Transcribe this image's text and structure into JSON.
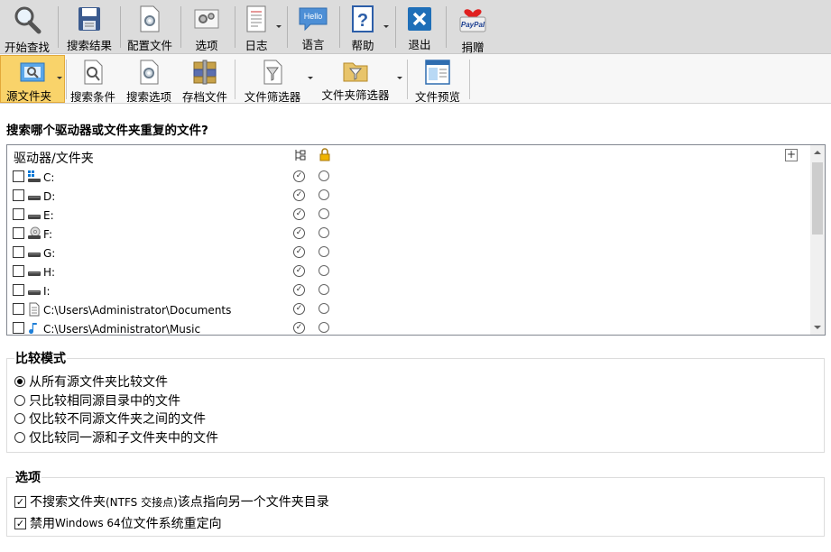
{
  "toolbar_main": {
    "items": [
      {
        "label": "开始查找",
        "icon": "magnifier-icon"
      },
      {
        "label": "搜索结果",
        "icon": "save-disk-icon"
      },
      {
        "label": "配置文件",
        "icon": "config-file-icon"
      },
      {
        "label": "选项",
        "icon": "options-gear-icon"
      },
      {
        "label": "日志",
        "icon": "log-icon"
      },
      {
        "label": "语言",
        "icon": "hello-bubble-icon"
      },
      {
        "label": "帮助",
        "icon": "help-icon"
      },
      {
        "label": "退出",
        "icon": "exit-x-icon"
      },
      {
        "label": "捐赠",
        "icon": "paypal-icon"
      }
    ],
    "hello_text": "Hello",
    "paypal_text": "PayPal"
  },
  "toolbar_sub": {
    "items": [
      {
        "label": "源文件夹",
        "icon": "source-folder-icon",
        "active": true
      },
      {
        "label": "搜索条件",
        "icon": "search-criteria-icon"
      },
      {
        "label": "搜索选项",
        "icon": "search-options-icon"
      },
      {
        "label": "存档文件",
        "icon": "archive-icon"
      },
      {
        "label": "文件筛选器",
        "icon": "file-filter-icon"
      },
      {
        "label": "文件夹筛选器",
        "icon": "folder-filter-icon"
      },
      {
        "label": "文件预览",
        "icon": "file-preview-icon"
      }
    ]
  },
  "question": "搜索哪个驱动器或文件夹重复的文件?",
  "drive_list": {
    "header": "驱动器/文件夹",
    "plus": "+",
    "rows": [
      {
        "name": "C:",
        "icon": "system-drive-icon"
      },
      {
        "name": "D:",
        "icon": "drive-icon"
      },
      {
        "name": "E:",
        "icon": "drive-icon"
      },
      {
        "name": "F:",
        "icon": "cd-drive-icon"
      },
      {
        "name": "G:",
        "icon": "drive-icon"
      },
      {
        "name": "H:",
        "icon": "drive-icon"
      },
      {
        "name": "I:",
        "icon": "drive-icon"
      },
      {
        "name": "C:\\Users\\Administrator\\Documents",
        "icon": "documents-folder-icon"
      },
      {
        "name": "C:\\Users\\Administrator\\Music",
        "icon": "music-folder-icon"
      }
    ]
  },
  "compare_mode": {
    "title": "比较模式",
    "options": [
      {
        "label": "从所有源文件夹比较文件",
        "selected": true
      },
      {
        "label": "只比较相同源目录中的文件",
        "selected": false
      },
      {
        "label": "仅比较不同源文件夹之间的文件",
        "selected": false
      },
      {
        "label": "仅比较同一源和子文件夹中的文件",
        "selected": false
      }
    ]
  },
  "options": {
    "title": "选项",
    "items": [
      {
        "pre": "不搜索文件夹 ",
        "small": "(NTFS 交接点)",
        "post": " 该点指向另一个文件夹目录",
        "checked": true
      },
      {
        "pre": "禁用 ",
        "small": "Windows 64",
        "post": " 位文件系统重定向",
        "checked": true
      }
    ]
  }
}
